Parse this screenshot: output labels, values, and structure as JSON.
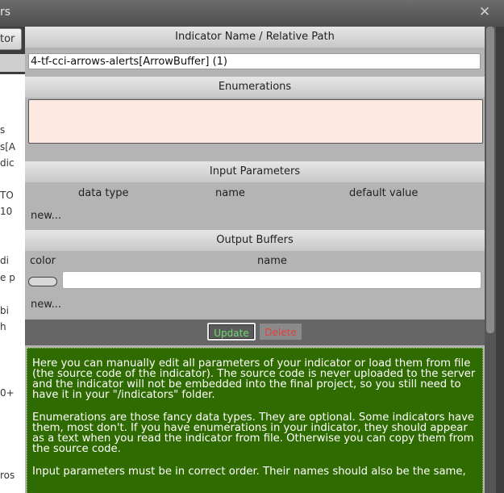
{
  "background_window": {
    "title_fragment": "rs",
    "button_fragment": "tor",
    "side_texts": [
      "s",
      "s[A",
      "dic",
      "TO",
      "10",
      "di",
      "e p",
      "bi",
      "h",
      "0+",
      "ros"
    ]
  },
  "dialog": {
    "indicator_section": {
      "header": "Indicator Name / Relative Path",
      "value": "4-tf-cci-arrows-alerts[ArrowBuffer] (1)"
    },
    "enumerations_section": {
      "header": "Enumerations",
      "value": ""
    },
    "input_parameters_section": {
      "header": "Input Parameters",
      "columns": [
        "data type",
        "name",
        "default value"
      ],
      "new_label": "new..."
    },
    "output_buffers_section": {
      "header": "Output Buffers",
      "columns": [
        "color",
        "name"
      ],
      "rows": [
        {
          "color": "",
          "name": ""
        }
      ],
      "new_label": "new..."
    },
    "actions": {
      "update_label": "Update",
      "delete_label": "Delete"
    },
    "help_paragraphs": [
      "Here you can manually edit all parameters of your indicator or load them from file (the source code of the indicator). The source code is never uploaded to the server and the indicator will not be embedded into the final project, so you still need to have it in your \"/indicators\" folder.",
      "Enumerations are those fancy data types. They are optional. Some indicators have them, most don't. If you have enumerations in your indicator, they should appear as a text when you read the indicator from file. Otherwise you can copy them from the source code.",
      "Input parameters must be in correct order. Their names should also be the same,"
    ]
  },
  "colors": {
    "help_background": "#2f6b00",
    "update_text": "#6fd86f",
    "delete_text": "#e04040",
    "enum_background": "#fde8e2"
  },
  "icons": {
    "close": "close-icon"
  }
}
